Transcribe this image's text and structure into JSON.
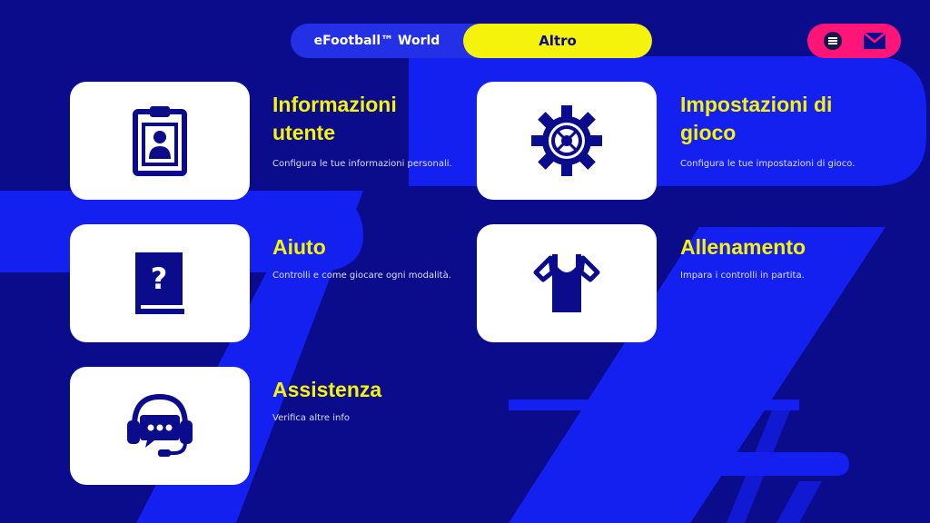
{
  "tabs": [
    {
      "label": "eFootball™ World",
      "active": false
    },
    {
      "label": "Altro",
      "active": true
    }
  ],
  "items": [
    {
      "title_line1": "Informazioni",
      "title_line2": "utente",
      "description": "Configura le tue informazioni personali.",
      "icon": "user-card-icon"
    },
    {
      "title_line1": "Impostazioni di",
      "title_line2": "gioco",
      "description": "Configura le tue impostazioni di gioco.",
      "icon": "gear-icon"
    },
    {
      "title_line1": "Aiuto",
      "description": "Controlli e come giocare ogni modalità.",
      "icon": "help-book-icon"
    },
    {
      "title_line1": "Allenamento",
      "description": "Impara i controlli in partita.",
      "icon": "training-shirt-icon"
    },
    {
      "title_line1": "Assistenza",
      "description": "Verifica altre info",
      "icon": "support-headset-icon"
    }
  ],
  "colors": {
    "background": "#0a0c8c",
    "accent_yellow": "#f5f20c",
    "accent_pink": "#ff1477",
    "stripe_blue": "#1420f0",
    "card": "#ffffff"
  }
}
